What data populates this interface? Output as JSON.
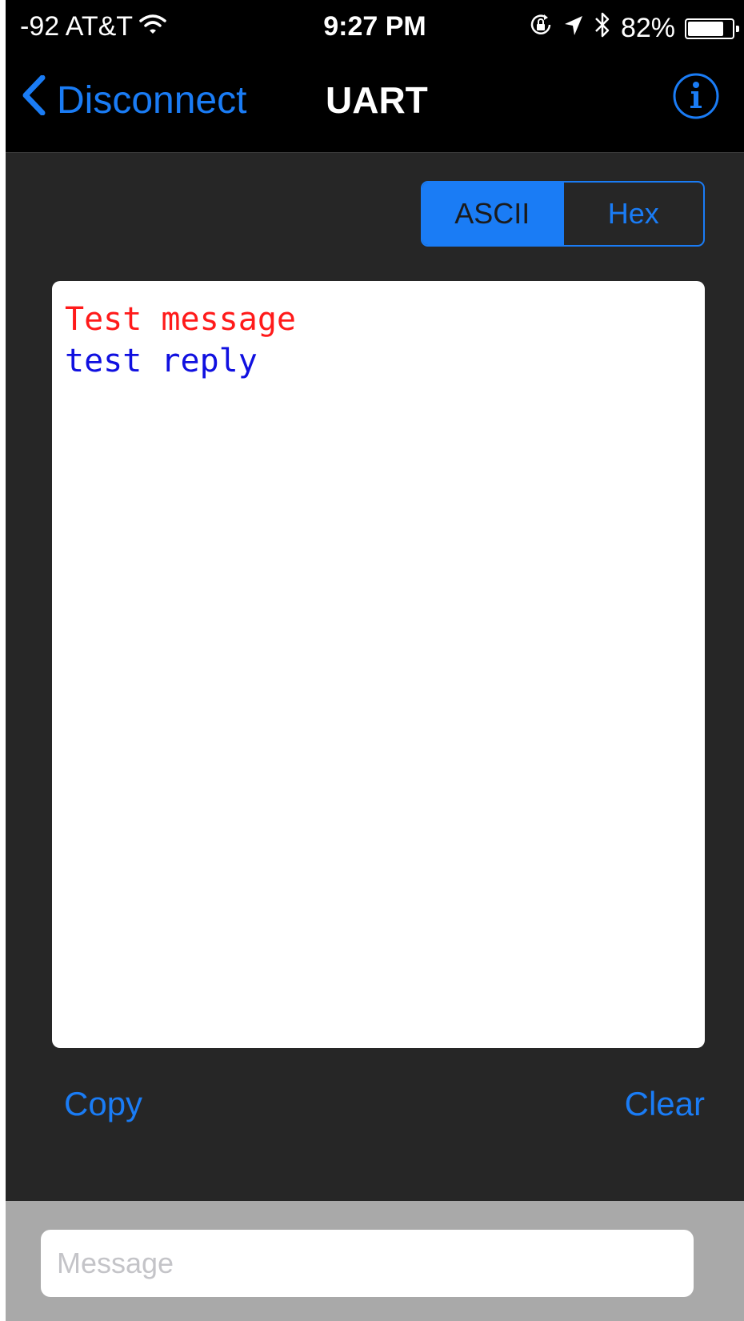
{
  "status_bar": {
    "carrier": "-92 AT&T",
    "time": "9:27 PM",
    "battery_percent": "82%",
    "battery_level": 0.82,
    "icons": [
      "wifi-icon",
      "rotation-lock-icon",
      "location-arrow-icon",
      "bluetooth-icon",
      "battery-icon"
    ]
  },
  "nav": {
    "back_label": "Disconnect",
    "title": "UART",
    "info_icon": "info-icon",
    "accent_color": "#1a7cf5"
  },
  "format_toggle": {
    "options": [
      "ASCII",
      "Hex"
    ],
    "selected": "ASCII"
  },
  "console": {
    "lines": [
      {
        "text": "Test message",
        "direction": "sent",
        "color": "#ff1a1a"
      },
      {
        "text": "test reply",
        "direction": "received",
        "color": "#1010e0"
      }
    ]
  },
  "actions": {
    "copy_label": "Copy",
    "clear_label": "Clear"
  },
  "input": {
    "value": "",
    "placeholder": "Message"
  }
}
